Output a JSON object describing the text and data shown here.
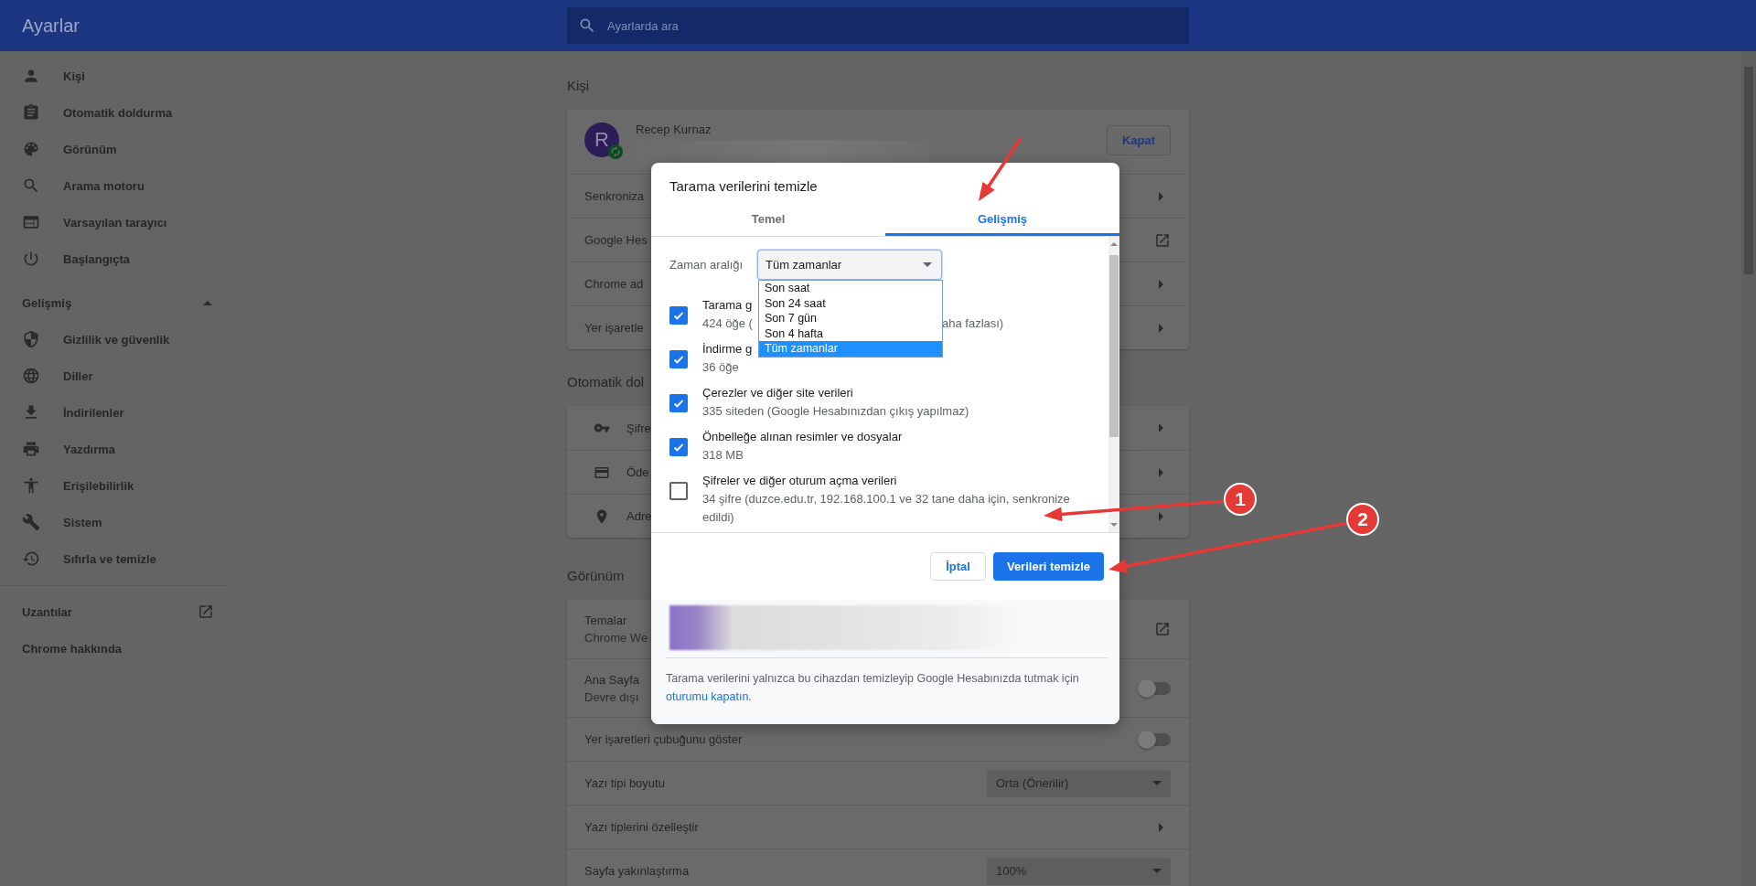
{
  "header": {
    "title": "Ayarlar",
    "search": {
      "placeholder": "Ayarlarda ara"
    }
  },
  "sidebar": {
    "items": [
      {
        "label": "Kişi"
      },
      {
        "label": "Otomatik doldurma"
      },
      {
        "label": "Görünüm"
      },
      {
        "label": "Arama motoru"
      },
      {
        "label": "Varsayılan tarayıcı"
      },
      {
        "label": "Başlangıçta"
      }
    ],
    "advanced": {
      "label": "Gelişmiş",
      "expanded": true,
      "items": [
        {
          "label": "Gizlilik ve güvenlik"
        },
        {
          "label": "Diller"
        },
        {
          "label": "İndirilenler"
        },
        {
          "label": "Yazdırma"
        },
        {
          "label": "Erişilebilirlik"
        },
        {
          "label": "Sistem"
        },
        {
          "label": "Sıfırla ve temizle"
        }
      ]
    },
    "links": [
      {
        "label": "Uzantılar",
        "kind": "external"
      },
      {
        "label": "Chrome hakkında",
        "kind": "plain"
      }
    ]
  },
  "sections": [
    {
      "title": "Kişi",
      "rows": [
        {
          "kind": "profile",
          "name": "Recep Kurnaz",
          "avatar_letter": "R",
          "button": "Kapat"
        },
        {
          "kind": "arrow",
          "label": "Senkroniza"
        },
        {
          "kind": "external",
          "label": "Google Hes"
        },
        {
          "kind": "arrow",
          "label": "Chrome ad"
        },
        {
          "kind": "arrow",
          "label": "Yer işaretle"
        }
      ]
    },
    {
      "title": "Otomatik dol",
      "rows": [
        {
          "kind": "arrow",
          "label": "Şifre"
        },
        {
          "kind": "arrow",
          "label": "Öde"
        },
        {
          "kind": "arrow",
          "label": "Adre"
        }
      ]
    },
    {
      "title": "Görünüm",
      "rows": [
        {
          "kind": "external",
          "label": "Temalar",
          "sublabel": "Chrome We"
        },
        {
          "kind": "toggle",
          "label": "Ana Sayfa",
          "sublabel": "Devre dışı",
          "on": false
        },
        {
          "kind": "toggle",
          "label": "Yer işaretleri çubuğunu göster",
          "on": false
        },
        {
          "kind": "select",
          "label": "Yazı tipi boyutu",
          "value": "Orta (Önerilir)"
        },
        {
          "kind": "arrow",
          "label": "Yazı tiplerini özelleştir"
        },
        {
          "kind": "select",
          "label": "Sayfa yakınlaştırma",
          "value": "100%"
        }
      ]
    }
  ],
  "dialog": {
    "title": "Tarama verilerini temizle",
    "tabs": [
      {
        "label": "Temel",
        "selected": false
      },
      {
        "label": "Gelişmiş",
        "selected": true
      }
    ],
    "time_range": {
      "label": "Zaman aralığı",
      "value": "Tüm zamanlar",
      "expanded": true,
      "options": [
        {
          "label": "Son saat",
          "selected": false
        },
        {
          "label": "Son 24 saat",
          "selected": false
        },
        {
          "label": "Son 7 gün",
          "selected": false
        },
        {
          "label": "Son 4 hafta",
          "selected": false
        },
        {
          "label": "Tüm zamanlar",
          "selected": true
        }
      ]
    },
    "items": [
      {
        "title": "Tarama g",
        "subtitle_parts": [
          "424 öğe (",
          "aha fazlası)"
        ],
        "checked": true
      },
      {
        "title": "İndirme g",
        "subtitle": "36 öğe",
        "checked": true
      },
      {
        "title": "Çerezler ve diğer site verileri",
        "subtitle": "335 siteden (Google Hesabınızdan çıkış yapılmaz)",
        "checked": true
      },
      {
        "title": "Önbelleğe alınan resimler ve dosyalar",
        "subtitle": "318 MB",
        "checked": true
      },
      {
        "title": "Şifreler ve diğer oturum açma verileri",
        "subtitle": "34 şifre (duzce.edu.tr, 192.168.100.1 ve 32 tane daha için, senkronize edildi)",
        "checked": false
      }
    ],
    "cancel": "İptal",
    "confirm": "Verileri temizle",
    "footer": {
      "text": "Tarama verilerini yalnızca bu cihazdan temizleyip Google Hesabınızda tutmak için",
      "link": "oturumu kapatın",
      "after": "."
    }
  },
  "annotations": [
    {
      "label": "1"
    },
    {
      "label": "2"
    }
  ]
}
